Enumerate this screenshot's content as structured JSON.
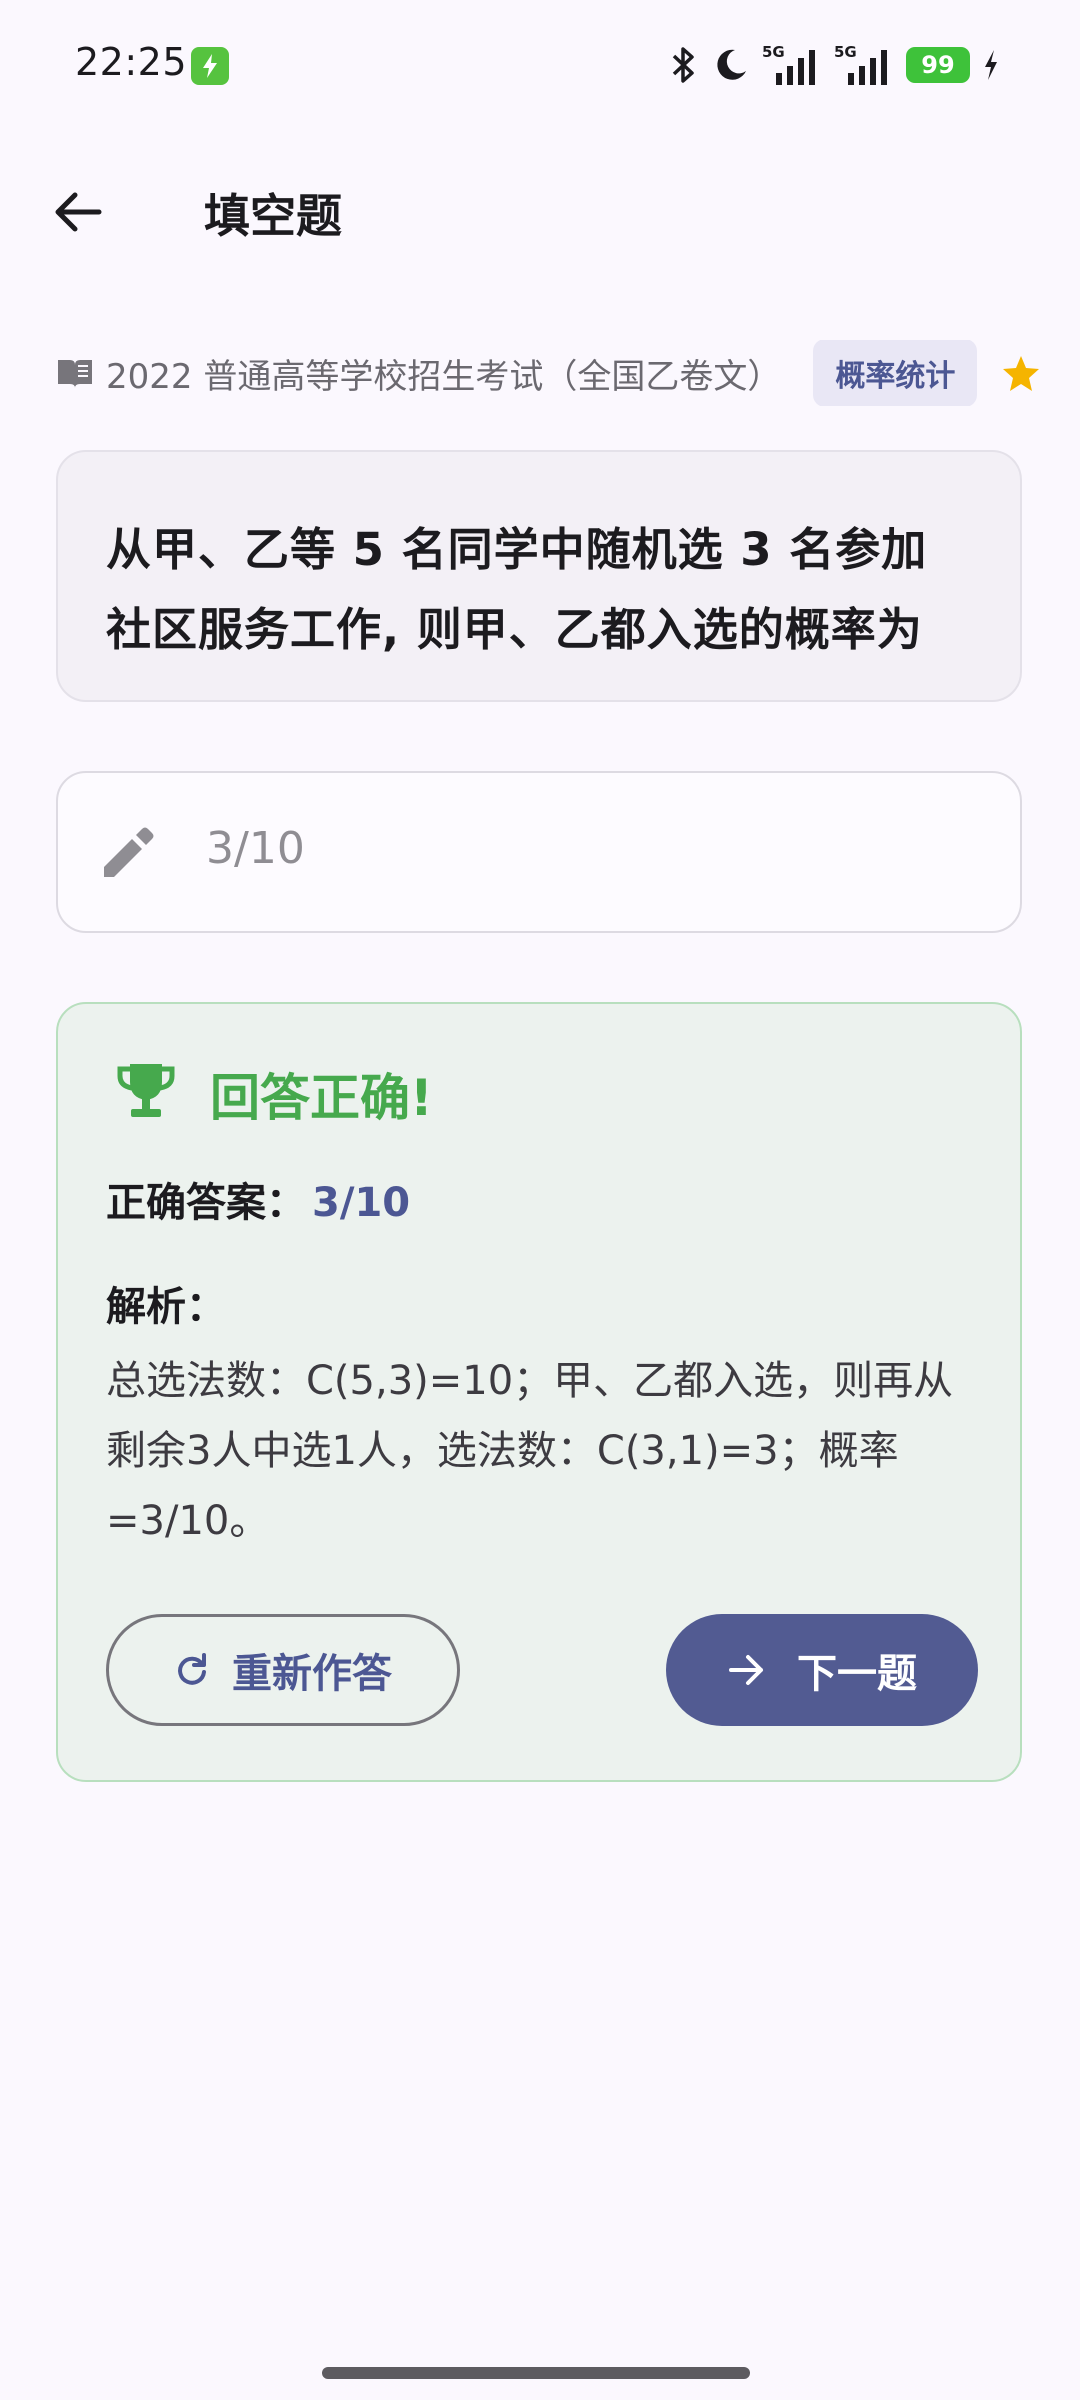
{
  "status_bar": {
    "time": "22:25",
    "network_1": "5G",
    "network_2": "5G",
    "battery": "99"
  },
  "app_bar": {
    "title": "填空题"
  },
  "source": {
    "text": "2022 普通高等学校招生考试（全国乙卷文）",
    "tag": "概率统计"
  },
  "question": {
    "text": "从甲、乙等 5 名同学中随机选 3 名参加社区服务工作, 则甲、乙都入选的概率为"
  },
  "answer_input": {
    "value": "3/10"
  },
  "result": {
    "title": "回答正确!",
    "correct_label": "正确答案：",
    "correct_value": "3/10",
    "analysis_label": "解析：",
    "analysis_text": "总选法数：C(5,3)=10；甲、乙都入选，则再从剩余3人中选1人，选法数：C(3,1)=3；概率=3/10。"
  },
  "buttons": {
    "retry": "重新作答",
    "next": "下一题"
  },
  "colors": {
    "accent": "#525b92",
    "success": "#46a94d",
    "star": "#f5b400"
  },
  "icons": [
    "charging-icon",
    "bluetooth-icon",
    "moon-icon",
    "signal-icon",
    "battery-icon",
    "back-arrow-icon",
    "book-icon",
    "star-icon",
    "pencil-icon",
    "trophy-icon",
    "refresh-icon",
    "arrow-right-icon"
  ]
}
